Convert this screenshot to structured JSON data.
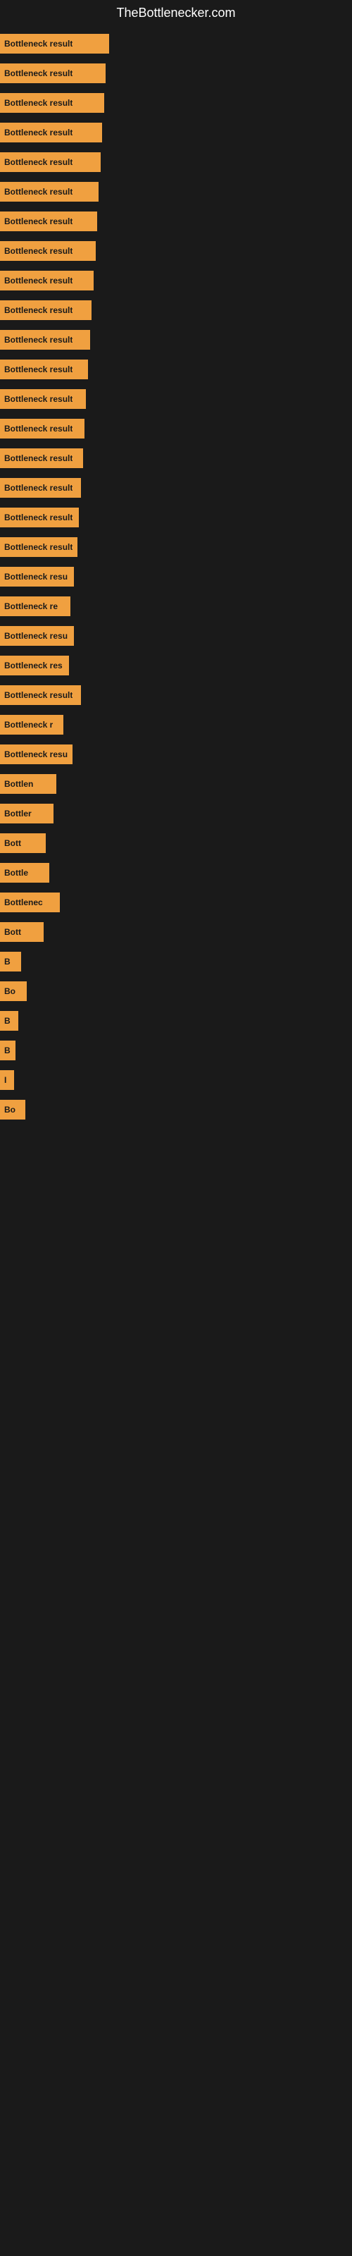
{
  "site": {
    "title": "TheBottlenecker.com"
  },
  "bars": [
    {
      "label": "Bottleneck result",
      "width": 155
    },
    {
      "label": "Bottleneck result",
      "width": 150
    },
    {
      "label": "Bottleneck result",
      "width": 148
    },
    {
      "label": "Bottleneck result",
      "width": 145
    },
    {
      "label": "Bottleneck result",
      "width": 143
    },
    {
      "label": "Bottleneck result",
      "width": 140
    },
    {
      "label": "Bottleneck result",
      "width": 138
    },
    {
      "label": "Bottleneck result",
      "width": 136
    },
    {
      "label": "Bottleneck result",
      "width": 133
    },
    {
      "label": "Bottleneck result",
      "width": 130
    },
    {
      "label": "Bottleneck result",
      "width": 128
    },
    {
      "label": "Bottleneck result",
      "width": 125
    },
    {
      "label": "Bottleneck result",
      "width": 122
    },
    {
      "label": "Bottleneck result",
      "width": 120
    },
    {
      "label": "Bottleneck result",
      "width": 118
    },
    {
      "label": "Bottleneck result",
      "width": 115
    },
    {
      "label": "Bottleneck result",
      "width": 112
    },
    {
      "label": "Bottleneck result",
      "width": 110
    },
    {
      "label": "Bottleneck resu",
      "width": 105
    },
    {
      "label": "Bottleneck re",
      "width": 100
    },
    {
      "label": "Bottleneck resu",
      "width": 105
    },
    {
      "label": "Bottleneck res",
      "width": 98
    },
    {
      "label": "Bottleneck result",
      "width": 115
    },
    {
      "label": "Bottleneck r",
      "width": 90
    },
    {
      "label": "Bottleneck resu",
      "width": 103
    },
    {
      "label": "Bottlen",
      "width": 80
    },
    {
      "label": "Bottler",
      "width": 76
    },
    {
      "label": "Bott",
      "width": 65
    },
    {
      "label": "Bottle",
      "width": 70
    },
    {
      "label": "Bottlenec",
      "width": 85
    },
    {
      "label": "Bott",
      "width": 62
    },
    {
      "label": "B",
      "width": 30
    },
    {
      "label": "Bo",
      "width": 38
    },
    {
      "label": "B",
      "width": 26
    },
    {
      "label": "B",
      "width": 22
    },
    {
      "label": "I",
      "width": 16
    },
    {
      "label": "Bo",
      "width": 36
    }
  ]
}
